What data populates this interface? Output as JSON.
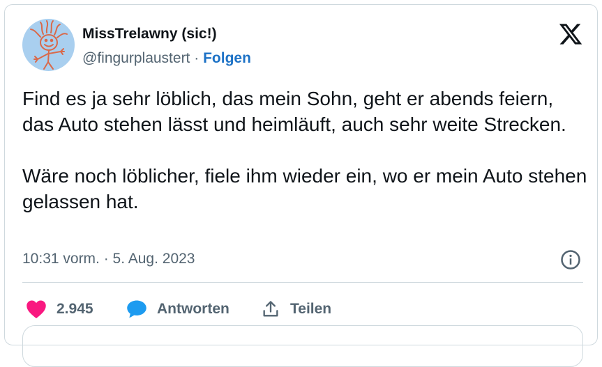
{
  "author": {
    "name": "MissTrelawny (sic!)",
    "handle": "@fingurplaustert",
    "separator": " · ",
    "follow_label": "Folgen"
  },
  "tweet": {
    "text": "Find es ja sehr löblich, das mein Sohn, geht er abends feiern, das Auto stehen lässt und heimläuft, auch sehr weite Strecken.\n\nWäre noch löblicher, fiele ihm wieder ein, wo er mein Auto stehen gelassen hat.",
    "timestamp": "10:31 vorm. · 5. Aug. 2023"
  },
  "actions": {
    "like_count": "2.945",
    "reply_label": "Antworten",
    "share_label": "Teilen"
  },
  "icons": {
    "logo": "x-logo-icon",
    "info": "info-icon",
    "like": "heart-icon",
    "reply": "speech-bubble-icon",
    "share": "share-icon"
  },
  "colors": {
    "text": "#0f1419",
    "secondary": "#536471",
    "link": "#1d72c6",
    "like": "#f91880",
    "reply": "#1d9bf0",
    "avatar_bg": "#a9cfef",
    "border": "#cfd9de"
  }
}
